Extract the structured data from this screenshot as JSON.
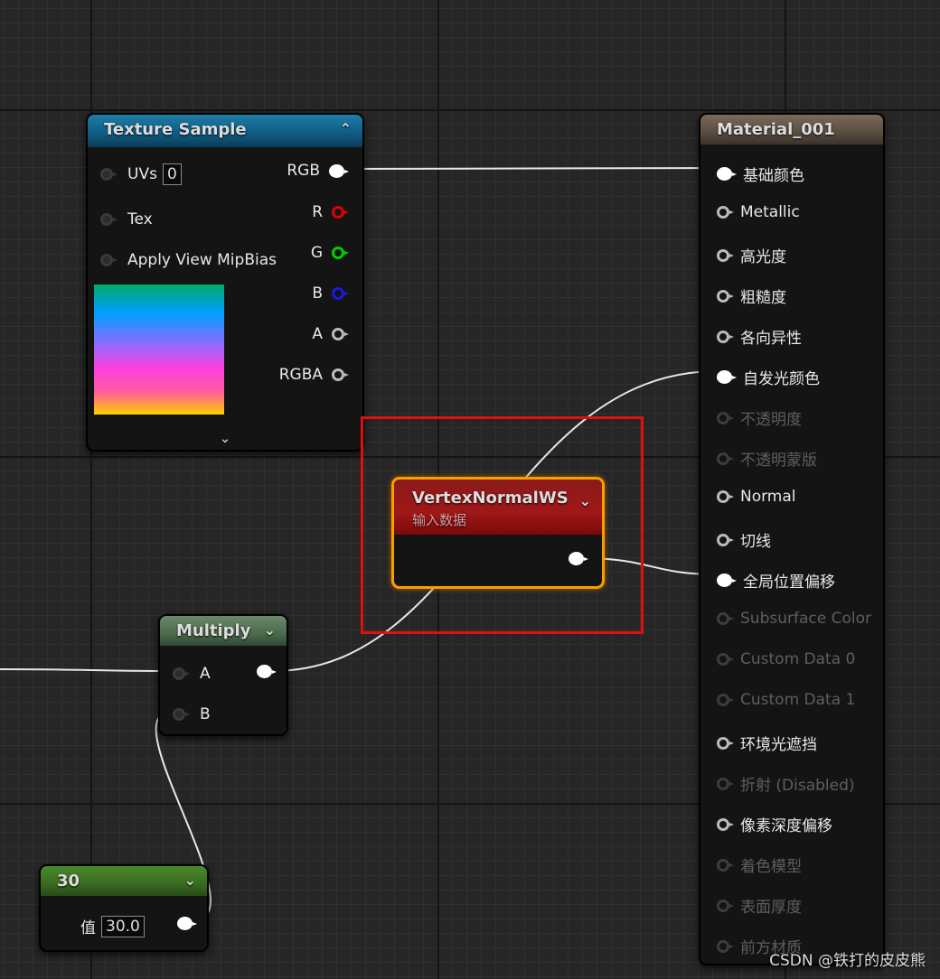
{
  "nodes": {
    "texture_sample": {
      "title": "Texture Sample",
      "inputs": [
        {
          "label": "UVs",
          "value": "0"
        },
        {
          "label": "Tex"
        },
        {
          "label": "Apply View MipBias"
        }
      ],
      "outputs": [
        "RGB",
        "R",
        "G",
        "B",
        "A",
        "RGBA"
      ]
    },
    "material": {
      "title": "Material_001",
      "inputs": [
        "基础颜色",
        "Metallic",
        "高光度",
        "粗糙度",
        "各向异性",
        "自发光颜色",
        "不透明度",
        "不透明蒙版",
        "Normal",
        "切线",
        "全局位置偏移",
        "Subsurface Color",
        "Custom Data 0",
        "Custom Data 1",
        "环境光遮挡",
        "折射 (Disabled)",
        "像素深度偏移",
        "着色模型",
        "表面厚度",
        "前方材质"
      ]
    },
    "vertex_normal": {
      "title": "VertexNormalWS",
      "subtitle": "输入数据"
    },
    "multiply": {
      "title": "Multiply",
      "inputs": [
        "A",
        "B"
      ]
    },
    "constant": {
      "title": "30",
      "value_label": "值",
      "value": "30.0"
    }
  },
  "watermark": "CSDN @铁打的皮皮熊"
}
